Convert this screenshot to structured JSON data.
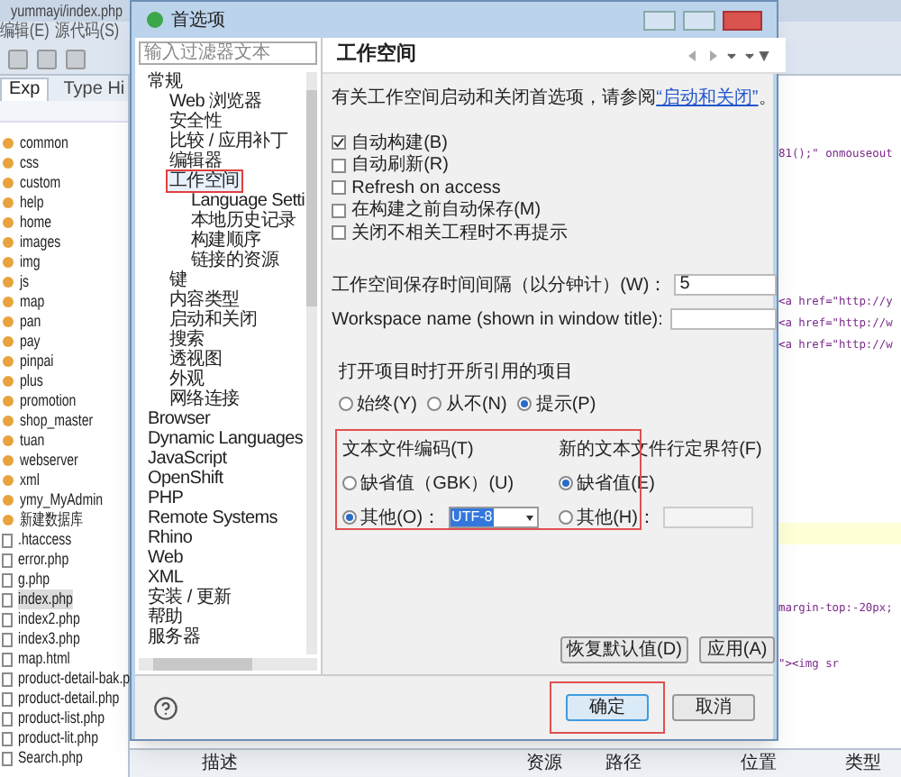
{
  "ide": {
    "title": "yummayi/index.php",
    "menu": [
      "编辑(E)",
      "源代码(S)"
    ],
    "tabs": [
      {
        "label": "Exp",
        "selected": true
      },
      {
        "label": "Type Hi",
        "selected": false
      }
    ],
    "explorer": [
      {
        "name": "common",
        "kind": "folder",
        "selected": false
      },
      {
        "name": "css",
        "kind": "folder",
        "selected": false
      },
      {
        "name": "custom",
        "kind": "folder",
        "selected": false
      },
      {
        "name": "help",
        "kind": "folder",
        "selected": false
      },
      {
        "name": "home",
        "kind": "folder",
        "selected": false
      },
      {
        "name": "images",
        "kind": "folder",
        "selected": false
      },
      {
        "name": "img",
        "kind": "folder",
        "selected": false
      },
      {
        "name": "js",
        "kind": "folder",
        "selected": false
      },
      {
        "name": "map",
        "kind": "folder",
        "selected": false
      },
      {
        "name": "pan",
        "kind": "folder",
        "selected": false
      },
      {
        "name": "pay",
        "kind": "folder",
        "selected": false
      },
      {
        "name": "pinpai",
        "kind": "folder",
        "selected": false
      },
      {
        "name": "plus",
        "kind": "folder",
        "selected": false
      },
      {
        "name": "promotion",
        "kind": "folder",
        "selected": false
      },
      {
        "name": "shop_master",
        "kind": "folder",
        "selected": false
      },
      {
        "name": "tuan",
        "kind": "folder",
        "selected": false
      },
      {
        "name": "webserver",
        "kind": "folder",
        "selected": false
      },
      {
        "name": "xml",
        "kind": "folder",
        "selected": false
      },
      {
        "name": "ymy_MyAdmin",
        "kind": "folder",
        "selected": false
      },
      {
        "name": "新建数据库",
        "kind": "folder",
        "selected": false
      },
      {
        "name": ".htaccess",
        "kind": "file",
        "selected": false
      },
      {
        "name": "error.php",
        "kind": "file",
        "selected": false
      },
      {
        "name": "g.php",
        "kind": "file",
        "selected": false
      },
      {
        "name": "index.php",
        "kind": "file",
        "selected": true
      },
      {
        "name": "index2.php",
        "kind": "file",
        "selected": false
      },
      {
        "name": "index3.php",
        "kind": "file",
        "selected": false
      },
      {
        "name": "map.html",
        "kind": "file",
        "selected": false
      },
      {
        "name": "product-detail-bak.p",
        "kind": "file",
        "selected": false
      },
      {
        "name": "product-detail.php",
        "kind": "file",
        "selected": false
      },
      {
        "name": "product-list.php",
        "kind": "file",
        "selected": false
      },
      {
        "name": "product-lit.php",
        "kind": "file",
        "selected": false
      },
      {
        "name": "Search.php",
        "kind": "file",
        "selected": false
      }
    ],
    "editor_lines": [
      "81();\" onmouseout",
      "<a href=\"http://y",
      "<a href=\"http://w",
      "<a href=\"http://w",
      "margin-top:-20px;",
      "\"><img sr"
    ],
    "problems_columns": [
      "描述",
      "资源",
      "路径",
      "位置",
      "类型"
    ]
  },
  "dialog": {
    "title": "首选项",
    "filter_placeholder": "输入过滤器文本",
    "tree": [
      {
        "label": "常规",
        "selected": false,
        "children": [
          {
            "label": "Web 浏览器",
            "selected": false
          },
          {
            "label": "安全性",
            "selected": false
          },
          {
            "label": "比较 / 应用补丁",
            "selected": false
          },
          {
            "label": "编辑器",
            "selected": false
          },
          {
            "label": "工作空间",
            "selected": true,
            "children": [
              {
                "label": "Language Setti",
                "selected": false
              },
              {
                "label": "本地历史记录",
                "selected": false
              },
              {
                "label": "构建顺序",
                "selected": false
              },
              {
                "label": "链接的资源",
                "selected": false
              }
            ]
          },
          {
            "label": "键",
            "selected": false
          },
          {
            "label": "内容类型",
            "selected": false
          },
          {
            "label": "启动和关闭",
            "selected": false
          },
          {
            "label": "搜索",
            "selected": false
          },
          {
            "label": "透视图",
            "selected": false
          },
          {
            "label": "外观",
            "selected": false
          },
          {
            "label": "网络连接",
            "selected": false
          }
        ]
      },
      {
        "label": "Browser",
        "selected": false
      },
      {
        "label": "Dynamic Languages",
        "selected": false
      },
      {
        "label": "JavaScript",
        "selected": false
      },
      {
        "label": "OpenShift",
        "selected": false
      },
      {
        "label": "PHP",
        "selected": false
      },
      {
        "label": "Remote Systems",
        "selected": false
      },
      {
        "label": "Rhino",
        "selected": false
      },
      {
        "label": "Web",
        "selected": false
      },
      {
        "label": "XML",
        "selected": false
      },
      {
        "label": "安装 / 更新",
        "selected": false
      },
      {
        "label": "帮助",
        "selected": false
      },
      {
        "label": "服务器",
        "selected": false
      }
    ],
    "heading": "工作空间",
    "description": {
      "text": "有关工作空间启动和关闭首选项，请参阅",
      "link": "“启动和关闭”",
      "end": "。"
    },
    "checkboxes": [
      {
        "label": "自动构建(B)",
        "checked": true
      },
      {
        "label": "自动刷新(R)",
        "checked": false
      },
      {
        "label": "Refresh on access",
        "checked": false
      },
      {
        "label": "在构建之前自动保存(M)",
        "checked": false
      },
      {
        "label": "关闭不相关工程时不再提示",
        "checked": false
      }
    ],
    "interval": {
      "label": "工作空间保存时间间隔（以分钟计）(W)：",
      "value": "5"
    },
    "workspace_name": {
      "label": "Workspace name (shown in window title):"
    },
    "open_referenced": {
      "label": "打开项目时打开所引用的项目",
      "options": [
        {
          "label": "始终(Y)",
          "selected": false
        },
        {
          "label": "从不(N)",
          "selected": false
        },
        {
          "label": "提示(P)",
          "selected": true
        }
      ]
    },
    "encoding": {
      "label": "文本文件编码(T)",
      "options": [
        {
          "label": "缺省值（GBK）(U)",
          "selected": false
        },
        {
          "label": "其他(O)：",
          "selected": true
        }
      ],
      "value": "UTF-8"
    },
    "delimiter": {
      "label": "新的文本文件行定界符(F)",
      "options": [
        {
          "label": "缺省值(E)",
          "selected": true
        },
        {
          "label": "其他(H)：",
          "selected": false
        }
      ]
    },
    "page_buttons": [
      "恢复默认值(D)",
      "应用(A)"
    ],
    "ok": "确定",
    "cancel": "取消"
  }
}
